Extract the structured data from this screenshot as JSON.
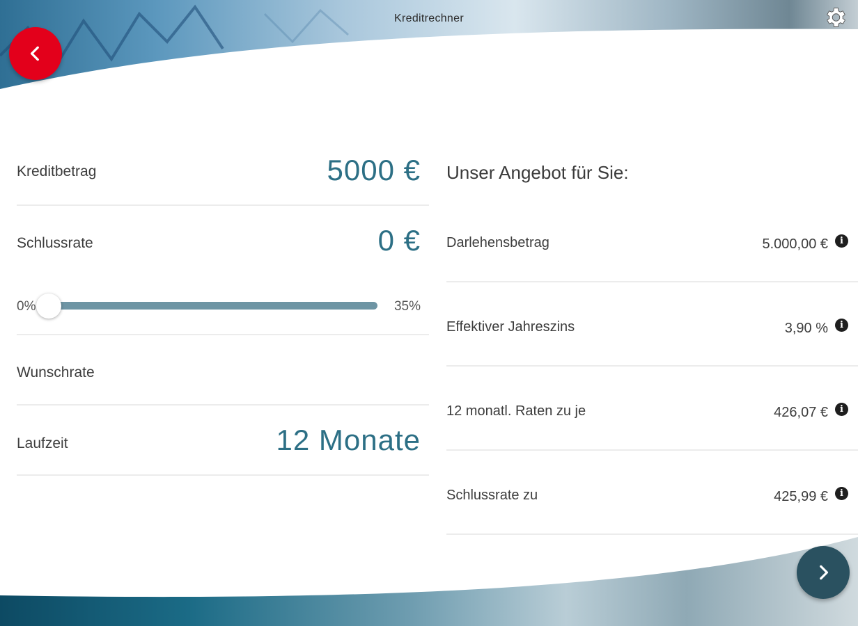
{
  "header": {
    "title": "Kreditrechner"
  },
  "icons": {
    "back": "chevron-left-icon",
    "settings": "gear-icon",
    "next": "chevron-right-icon",
    "info": "info-icon"
  },
  "colors": {
    "back_button": "#e3001b",
    "next_button": "#2a5160",
    "value_text": "#2c6f85",
    "slider_track": "#6e95a4"
  },
  "form": {
    "kreditbetrag": {
      "label": "Kreditbetrag",
      "value": "5000  €"
    },
    "schlussrate": {
      "label": "Schlussrate",
      "value": "0  €"
    },
    "slider": {
      "min_label": "0%",
      "max_label": "35%",
      "value_fraction": 0
    },
    "wunschrate": {
      "label": "Wunschrate"
    },
    "laufzeit": {
      "label": "Laufzeit",
      "value": "12  Monate"
    }
  },
  "offer": {
    "heading": "Unser Angebot für Sie:",
    "rows": [
      {
        "label": "Darlehensbetrag",
        "value": "5.000,00 €"
      },
      {
        "label": "Effektiver Jahreszins",
        "value": "3,90 %"
      },
      {
        "label": "12 monatl. Raten zu je",
        "value": "426,07 €"
      },
      {
        "label": "Schlussrate zu",
        "value": "425,99 €"
      }
    ]
  }
}
